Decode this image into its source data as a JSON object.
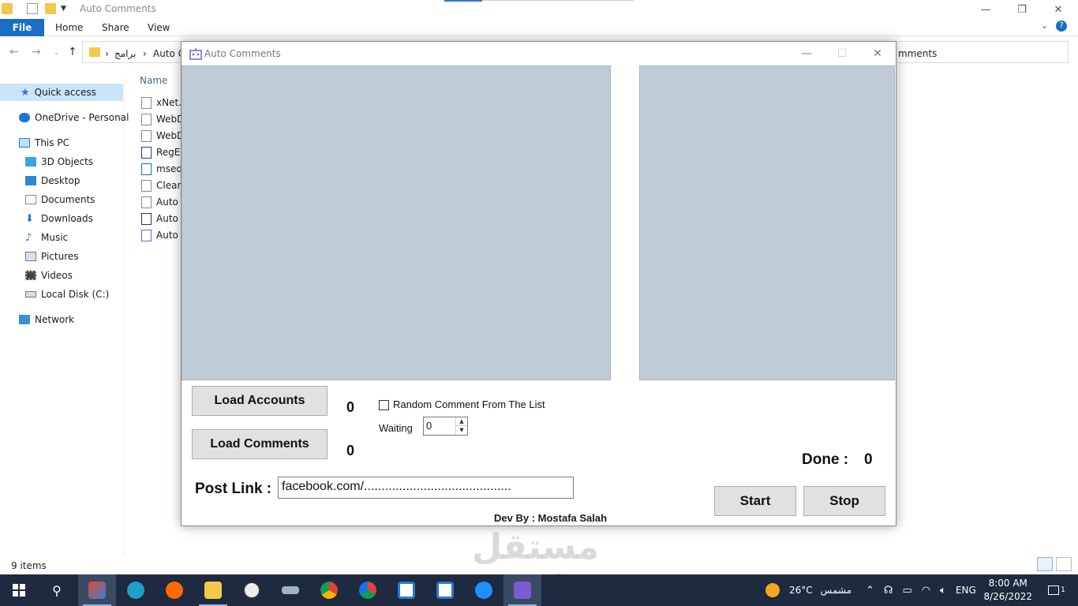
{
  "explorer": {
    "title": "Auto Comments",
    "ribbon_tabs": [
      "File",
      "Home",
      "Share",
      "View"
    ],
    "breadcrumb": [
      "برامج",
      "Auto C"
    ],
    "breadcrumb_tail": "mments",
    "nav_items": [
      {
        "label": "Quick access",
        "icon": "star-icon"
      },
      {
        "label": "OneDrive - Personal",
        "icon": "cloud-icon"
      },
      {
        "label": "This PC",
        "icon": "computer-icon"
      },
      {
        "label": "3D Objects",
        "icon": "cube-icon"
      },
      {
        "label": "Desktop",
        "icon": "desktop-icon"
      },
      {
        "label": "Documents",
        "icon": "document-icon"
      },
      {
        "label": "Downloads",
        "icon": "download-icon"
      },
      {
        "label": "Music",
        "icon": "music-icon"
      },
      {
        "label": "Pictures",
        "icon": "picture-icon"
      },
      {
        "label": "Videos",
        "icon": "video-icon"
      },
      {
        "label": "Local Disk (C:)",
        "icon": "disk-icon"
      },
      {
        "label": "Network",
        "icon": "network-icon"
      }
    ],
    "column_header": "Name",
    "files": [
      "xNet.d",
      "WebD",
      "WebD",
      "RegEx",
      "msedg",
      "Clean",
      "Auto C",
      "Auto C",
      "Auto C"
    ],
    "status": "9 items"
  },
  "app": {
    "title": "Auto Comments",
    "load_accounts_label": "Load Accounts",
    "load_comments_label": "Load Comments",
    "accounts_count": "0",
    "comments_count": "0",
    "random_comment_label": "Random Comment From The List",
    "random_comment_checked": false,
    "waiting_label": "Waiting",
    "waiting_value": "0",
    "done_label": "Done :",
    "done_count": "0",
    "post_link_label": "Post Link :",
    "post_link_value": "facebook.com/..........................................",
    "start_label": "Start",
    "stop_label": "Stop",
    "dev_credit": "Dev By : Mostafa Salah",
    "panel_color": "#bfcbd7"
  },
  "watermark": {
    "arabic": "مستقل",
    "latin": "mostaql.com"
  },
  "taskbar": {
    "weather_temp": "26°C",
    "weather_text": "مشمس",
    "language": "ENG",
    "time": "8:00 AM",
    "date": "8/26/2022",
    "notification_count": "1",
    "apps": [
      "tool-app-icon",
      "edge-icon",
      "soundcloud-icon",
      "file-explorer-icon",
      "clock-app-icon",
      "ship-app-icon",
      "chrome-icon",
      "chrome-canary-icon",
      "window-app-icon",
      "window-app-icon",
      "dollar-app-icon",
      "auto-comments-app-icon"
    ]
  }
}
